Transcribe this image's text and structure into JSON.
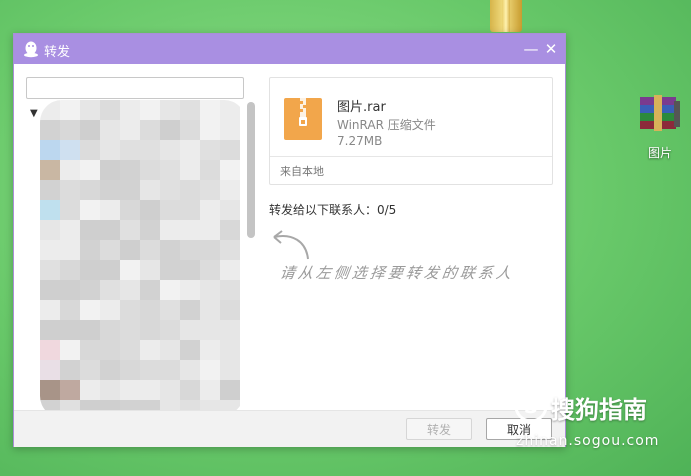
{
  "dialog": {
    "title": "转发",
    "icons": {
      "app": "qq-penguin-icon",
      "minimize": "minimize-icon",
      "close": "close-icon"
    },
    "minimize_label": "—",
    "close_label": "✕"
  },
  "search": {
    "value": "",
    "placeholder": ""
  },
  "contact_tree": {
    "collapse_arrow": "▼"
  },
  "file": {
    "name": "图片.rar",
    "type": "WinRAR 压缩文件",
    "size": "7.27MB",
    "source": "来自本地",
    "icon": "zip-archive-icon"
  },
  "forward": {
    "label": "转发给以下联系人：0/5"
  },
  "hint": {
    "text": "请从左侧选择要转发的联系人"
  },
  "buttons": {
    "forward": "转发",
    "cancel": "取消"
  },
  "desktop": {
    "icon_label": "图片",
    "icon": "winrar-archive-icon"
  },
  "watermark": {
    "text": "搜狗指南",
    "url": "zhinan.sogou.com"
  },
  "colors": {
    "titlebar": "#a98fe2",
    "desktop": "#69c96a",
    "file_icon": "#f2a64b"
  }
}
